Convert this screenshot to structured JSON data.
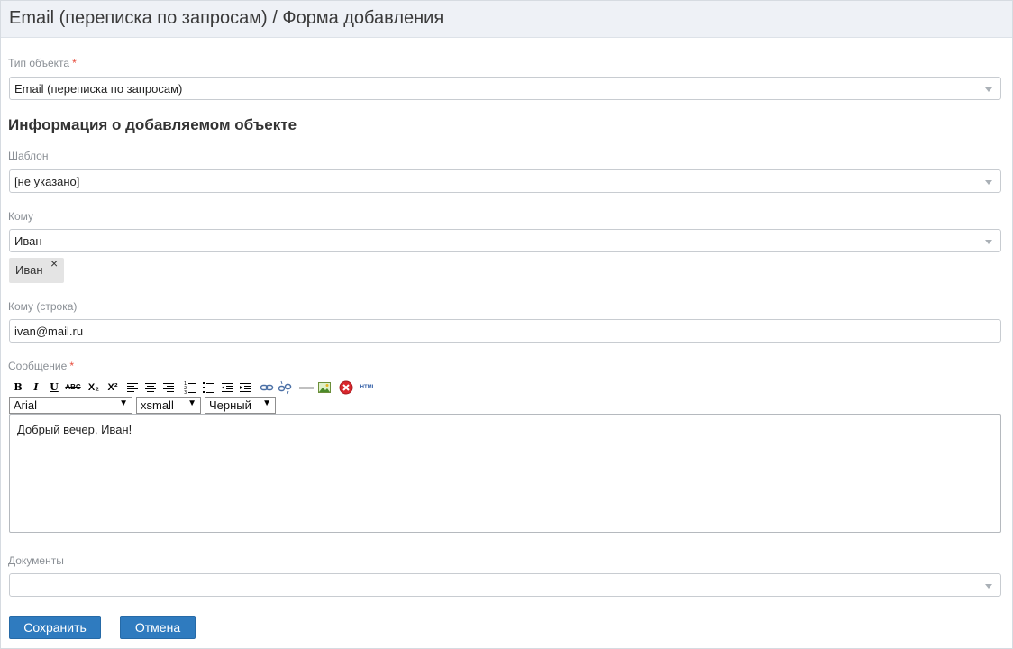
{
  "page": {
    "title": "Email (переписка по запросам) / Форма добавления"
  },
  "form": {
    "object_type": {
      "label": "Тип объекта",
      "required_mark": "*",
      "value": "Email (переписка по запросам)"
    },
    "section_heading": "Информация о добавляемом объекте",
    "template": {
      "label": "Шаблон",
      "value": "[не указано]"
    },
    "to": {
      "label": "Кому",
      "value": "Иван",
      "tags": [
        "Иван"
      ],
      "tag_remove_glyph": "×"
    },
    "to_string": {
      "label": "Кому (строка)",
      "value": "ivan@mail.ru"
    },
    "message": {
      "label": "Сообщение",
      "required_mark": "*",
      "font_family": "Arial",
      "font_size": "xsmall",
      "font_color": "Черный",
      "dropdown_glyph": "▼",
      "body": "Добрый вечер, Иван!",
      "toolbar": {
        "bold": "B",
        "italic": "I",
        "underline": "U",
        "strikethrough": "ABC",
        "subscript": "X₂",
        "superscript": "X²",
        "html": "HTML",
        "icons": [
          "bold-icon",
          "italic-icon",
          "underline-icon",
          "strikethrough-icon",
          "subscript-icon",
          "superscript-icon",
          "align-left-icon",
          "align-center-icon",
          "align-right-icon",
          "ordered-list-icon",
          "unordered-list-icon",
          "outdent-icon",
          "indent-icon",
          "link-icon",
          "unlink-icon",
          "horizontal-rule-icon",
          "insert-image-icon",
          "remove-format-icon",
          "html-icon"
        ]
      }
    },
    "documents": {
      "label": "Документы",
      "value": ""
    }
  },
  "actions": {
    "save_label": "Сохранить",
    "cancel_label": "Отмена"
  },
  "colors": {
    "primary_button": "#2f7bbf",
    "required": "#e74c3c",
    "header_bg": "#eef1f6",
    "label": "#8a8f95"
  }
}
